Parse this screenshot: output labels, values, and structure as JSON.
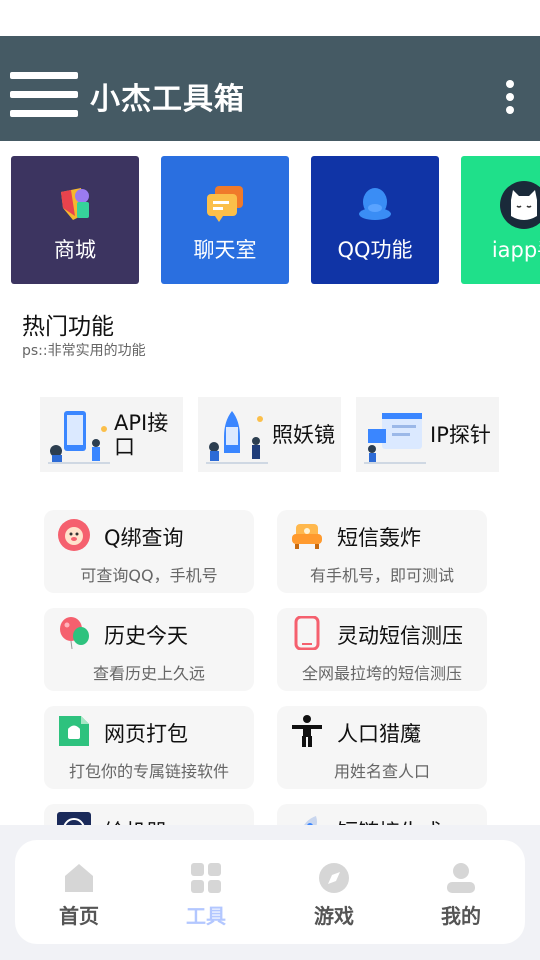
{
  "app": {
    "title": "小杰工具箱"
  },
  "tiles": [
    {
      "label": "商城",
      "color": "#3c3460"
    },
    {
      "label": "聊天室",
      "color": "#2a6fe0"
    },
    {
      "label": "QQ功能",
      "color": "#1034a6"
    },
    {
      "label": "iapp手",
      "color": "#1fe08a"
    }
  ],
  "section": {
    "title": "热门功能",
    "subtitle": "ps::非常实用的功能"
  },
  "promos": [
    {
      "label": "API接口"
    },
    {
      "label": "照妖镜"
    },
    {
      "label": "IP探针"
    }
  ],
  "cards": [
    {
      "name": "Q绑查询",
      "desc": "可查询QQ，手机号",
      "icon": "lion-icon"
    },
    {
      "name": "短信轰炸",
      "desc": "有手机号，即可测试",
      "icon": "sofa-icon"
    },
    {
      "name": "历史今天",
      "desc": "查看历史上久远",
      "icon": "balloon-icon"
    },
    {
      "name": "灵动短信测压",
      "desc": "全网最拉垮的短信测压",
      "icon": "phone-icon"
    },
    {
      "name": "网页打包",
      "desc": "打包你的专属链接软件",
      "icon": "android-icon"
    },
    {
      "name": "人口猎魔",
      "desc": "用姓名查人口",
      "icon": "person-icon"
    },
    {
      "name": "绘机器",
      "desc": "",
      "icon": "robot-icon"
    },
    {
      "name": "短链接生成",
      "desc": "",
      "icon": "rocket-icon"
    }
  ],
  "nav": {
    "items": [
      {
        "label": "首页",
        "icon": "home-icon"
      },
      {
        "label": "工具",
        "icon": "grid-icon"
      },
      {
        "label": "游戏",
        "icon": "compass-icon"
      },
      {
        "label": "我的",
        "icon": "user-icon"
      }
    ],
    "active_index": 1,
    "active_color": "#b3c7ff",
    "inactive_color": "#555555"
  }
}
